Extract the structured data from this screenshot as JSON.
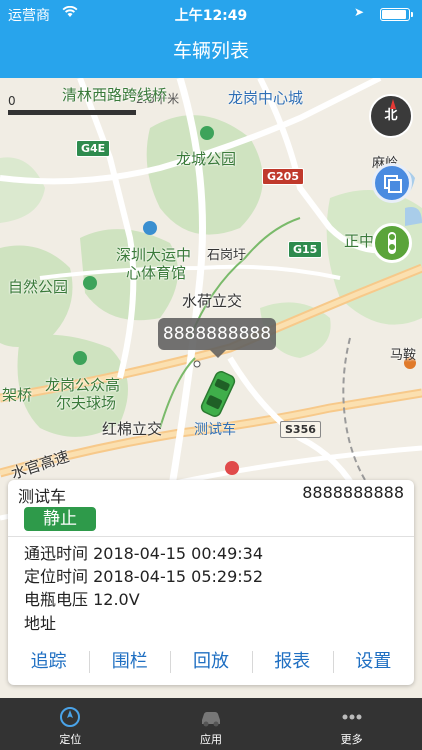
{
  "status_bar": {
    "carrier": "运营商",
    "time": "上午12:49"
  },
  "nav": {
    "title": "车辆列表"
  },
  "map": {
    "scale_label": "0",
    "scale_tick": "2.5千米",
    "labels": [
      "清林西路跨线桥",
      "龙岗中心城",
      "龙城公园",
      "深圳大运中",
      "心体育馆",
      "石岗圩",
      "自然公园",
      "水荷立交",
      "龙岗公众高",
      "尔夫球场",
      "架桥",
      "红棉立交",
      "水官高速",
      "马鞍",
      "正中",
      "麻岭"
    ],
    "shields": [
      "G4E",
      "G205",
      "G15",
      "S356"
    ],
    "compass_label": "北",
    "vehicle_bubble": "8888888888",
    "vehicle_label": "测试车"
  },
  "vehicle": {
    "name": "测试车",
    "plate": "8888888888",
    "status": "静止",
    "comm_time": "通迅时间 2018-04-15 00:49:34",
    "pos_time": "定位时间 2018-04-15 05:29:52",
    "battery": "电瓶电压 12.0V",
    "address": "地址"
  },
  "actions": [
    "追踪",
    "围栏",
    "回放",
    "报表",
    "设置"
  ],
  "tabs": [
    {
      "label": "定位",
      "icon": "locate-icon"
    },
    {
      "label": "应用",
      "icon": "car-icon"
    },
    {
      "label": "更多",
      "icon": "more-icon"
    }
  ],
  "colors": {
    "brand": "#28a4ec",
    "status_green": "#2e9a4a",
    "action_blue": "#1f6fc2",
    "tab_bar": "#333333"
  }
}
